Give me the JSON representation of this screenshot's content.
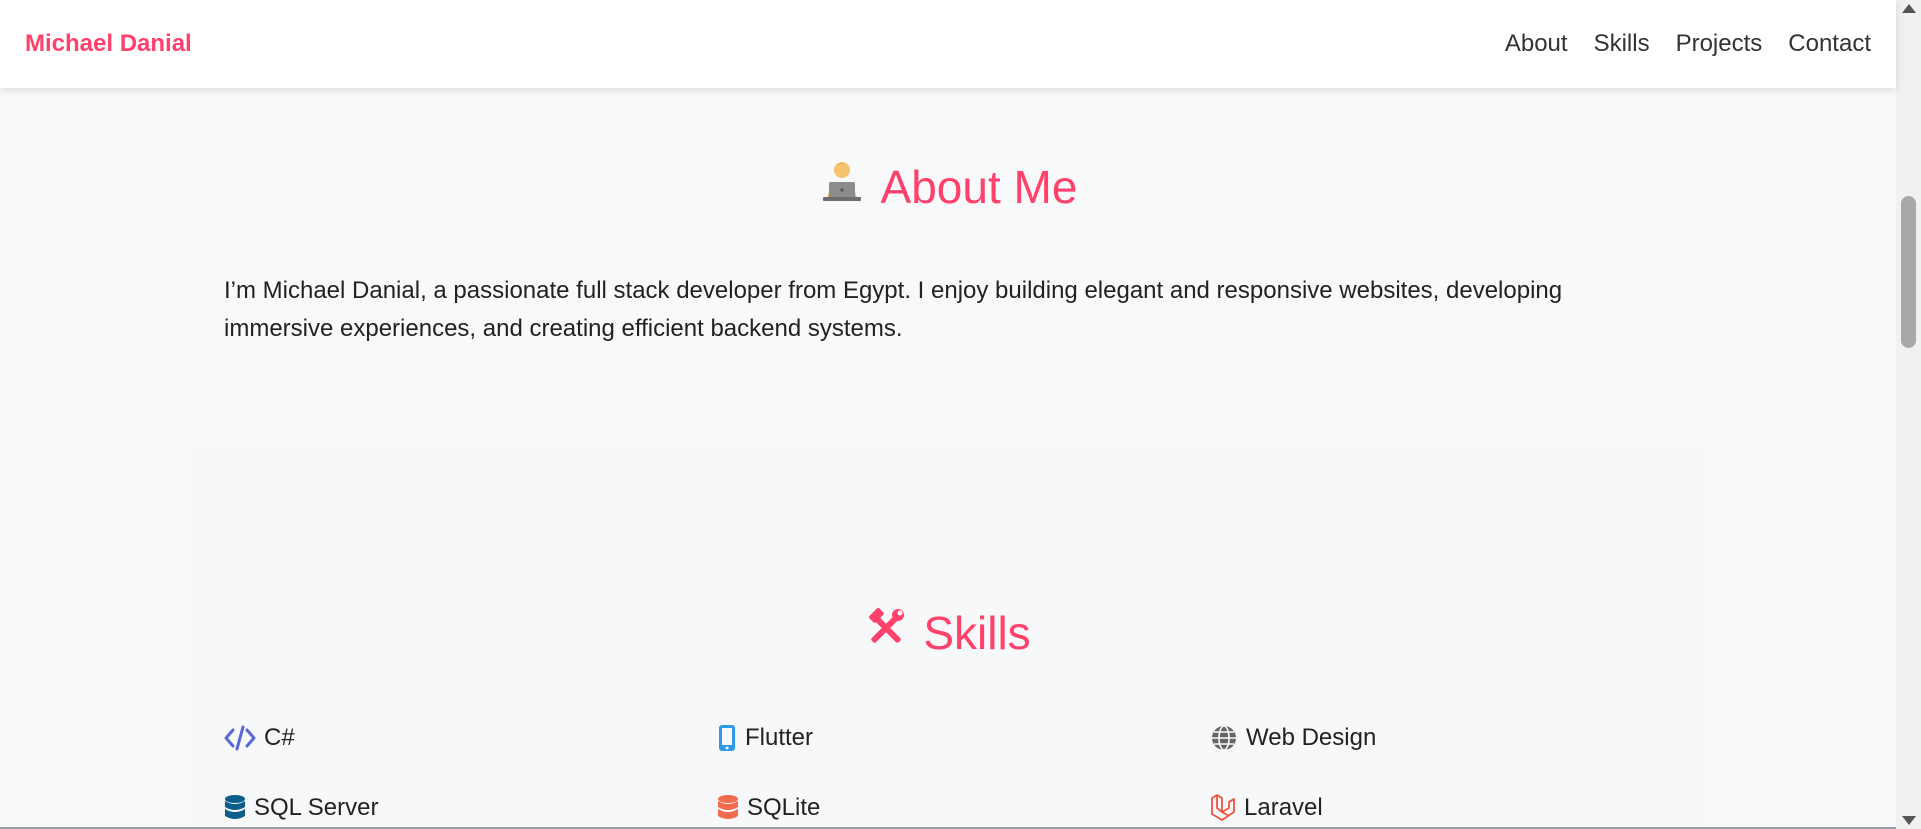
{
  "nav": {
    "brand": "Michael Danial",
    "links": [
      "About",
      "Skills",
      "Projects",
      "Contact"
    ]
  },
  "about": {
    "icon": "technologist-emoji",
    "title": "About Me",
    "text": "I’m Michael Danial, a passionate full stack developer from Egypt. I enjoy building elegant and responsive websites, developing immersive experiences, and creating efficient backend systems."
  },
  "skills": {
    "icon": "hammer-wrench-icon",
    "title": "Skills",
    "items": [
      {
        "label": "C#",
        "icon": "code-icon",
        "color": "#5a67d8"
      },
      {
        "label": "Flutter",
        "icon": "mobile-phone-icon",
        "color": "#2f9be8"
      },
      {
        "label": "Web Design",
        "icon": "globe-icon",
        "color": "#666666"
      },
      {
        "label": "SQL Server",
        "icon": "database-icon",
        "color": "#0b5e8a"
      },
      {
        "label": "SQLite",
        "icon": "database-icon",
        "color": "#f26b4f"
      },
      {
        "label": "Laravel",
        "icon": "laravel-icon",
        "color": "#f05340"
      }
    ]
  },
  "colors": {
    "accent": "#ff416c",
    "background": "#f8f9fa"
  }
}
